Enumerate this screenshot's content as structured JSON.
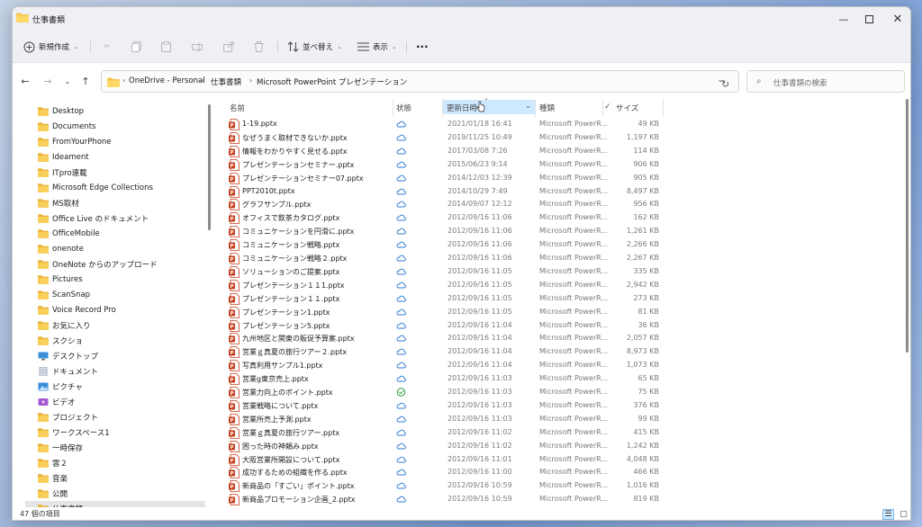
{
  "window": {
    "title": "仕事書類"
  },
  "toolbar": {
    "new_label": "新規作成",
    "sort_label": "並べ替え",
    "view_label": "表示",
    "more_label": "···"
  },
  "address": {
    "crumbs": [
      "OneDrive - Personal",
      "仕事書類",
      "Microsoft PowerPoint プレゼンテーション"
    ],
    "search_placeholder": "仕事書類の検索"
  },
  "sidebar": {
    "items": [
      "Desktop",
      "Documents",
      "FromYourPhone",
      "Ideament",
      "ITpro連載",
      "Microsoft Edge Collections",
      "MS取材",
      "Office Live のドキュメント",
      "OfficeMobile",
      "onenote",
      "OneNote からのアップロード",
      "Pictures",
      "ScanSnap",
      "Voice Record Pro",
      "お気に入り",
      "スクショ",
      "デスクトップ",
      "ドキュメント",
      "ピクチャ",
      "ビデオ",
      "プロジェクト",
      "ワークスペース1",
      "一時保存",
      "雲２",
      "音楽",
      "公開",
      "仕事書類"
    ],
    "icons": [
      "folder",
      "folder",
      "folder",
      "folder",
      "folder",
      "folder",
      "folder",
      "folder",
      "folder",
      "folder",
      "folder",
      "folder",
      "folder",
      "folder",
      "folder",
      "folder",
      "desktop",
      "document",
      "picture",
      "video",
      "folder",
      "folder",
      "folder",
      "folder",
      "folder",
      "folder",
      "folder"
    ]
  },
  "columns": {
    "name": "名前",
    "status": "状態",
    "modified": "更新日時",
    "type": "種類",
    "size": "サイズ"
  },
  "files": [
    {
      "name": "1-19.pptx",
      "status": "cloud",
      "modified": "2021/01/18 16:41",
      "type": "Microsoft PowerR...",
      "size": "49 KB"
    },
    {
      "name": "なぜうまく取材できないか.pptx",
      "status": "cloud",
      "modified": "2019/11/25 10:49",
      "type": "Microsoft PowerR...",
      "size": "1,197 KB"
    },
    {
      "name": "情報をわかりやすく見せる.pptx",
      "status": "cloud",
      "modified": "2017/03/08 7:26",
      "type": "Microsoft PowerR...",
      "size": "114 KB"
    },
    {
      "name": "プレゼンテーションセミナー.pptx",
      "status": "cloud",
      "modified": "2015/06/23 9:14",
      "type": "Microsoft PowerR...",
      "size": "906 KB"
    },
    {
      "name": "プレゼンテーションセミナー07.pptx",
      "status": "cloud",
      "modified": "2014/12/03 12:39",
      "type": "Microsoft PowerR...",
      "size": "905 KB"
    },
    {
      "name": "PPT2010t.pptx",
      "status": "cloud",
      "modified": "2014/10/29 7:49",
      "type": "Microsoft PowerR...",
      "size": "8,497 KB"
    },
    {
      "name": "グラフサンプル.pptx",
      "status": "cloud",
      "modified": "2014/09/07 12:12",
      "type": "Microsoft PowerR...",
      "size": "956 KB"
    },
    {
      "name": "オフィスで飲茶カタログ.pptx",
      "status": "cloud",
      "modified": "2012/09/16 11:06",
      "type": "Microsoft PowerR...",
      "size": "162 KB"
    },
    {
      "name": "コミュニケーションを円滑に.pptx",
      "status": "cloud",
      "modified": "2012/09/16 11:06",
      "type": "Microsoft PowerR...",
      "size": "1,261 KB"
    },
    {
      "name": "コミュニケーション戦略.pptx",
      "status": "cloud",
      "modified": "2012/09/16 11:06",
      "type": "Microsoft PowerR...",
      "size": "2,266 KB"
    },
    {
      "name": "コミュニケーション戦略２.pptx",
      "status": "cloud",
      "modified": "2012/09/16 11:06",
      "type": "Microsoft PowerR...",
      "size": "2,267 KB"
    },
    {
      "name": "ソリューションのご提案.pptx",
      "status": "cloud",
      "modified": "2012/09/16 11:05",
      "type": "Microsoft PowerR...",
      "size": "335 KB"
    },
    {
      "name": "プレゼンテーション１１1.pptx",
      "status": "cloud",
      "modified": "2012/09/16 11:05",
      "type": "Microsoft PowerR...",
      "size": "2,942 KB"
    },
    {
      "name": "プレゼンテーション１１.pptx",
      "status": "cloud",
      "modified": "2012/09/16 11:05",
      "type": "Microsoft PowerR...",
      "size": "273 KB"
    },
    {
      "name": "プレゼンテーション1.pptx",
      "status": "cloud",
      "modified": "2012/09/16 11:05",
      "type": "Microsoft PowerR...",
      "size": "81 KB"
    },
    {
      "name": "プレゼンテーション5.pptx",
      "status": "cloud",
      "modified": "2012/09/16 11:04",
      "type": "Microsoft PowerR...",
      "size": "36 KB"
    },
    {
      "name": "九州地区と関東の販促予算案.pptx",
      "status": "cloud",
      "modified": "2012/09/16 11:04",
      "type": "Microsoft PowerR...",
      "size": "2,057 KB"
    },
    {
      "name": "営業ｇ真夏の旅行ツアー２.pptx",
      "status": "cloud",
      "modified": "2012/09/16 11:04",
      "type": "Microsoft PowerR...",
      "size": "8,973 KB"
    },
    {
      "name": "写真利用サンプル1.pptx",
      "status": "cloud",
      "modified": "2012/09/16 11:04",
      "type": "Microsoft PowerR...",
      "size": "1,073 KB"
    },
    {
      "name": "営業g東京売上.pptx",
      "status": "cloud",
      "modified": "2012/09/16 11:03",
      "type": "Microsoft PowerR...",
      "size": "65 KB"
    },
    {
      "name": "営業力向上のポイント.pptx",
      "status": "synced",
      "modified": "2012/09/16 11:03",
      "type": "Microsoft PowerR...",
      "size": "75 KB"
    },
    {
      "name": "営業戦略について.pptx",
      "status": "cloud",
      "modified": "2012/09/16 11:03",
      "type": "Microsoft PowerR...",
      "size": "376 KB"
    },
    {
      "name": "営業所売上予測.pptx",
      "status": "cloud",
      "modified": "2012/09/16 11:03",
      "type": "Microsoft PowerR...",
      "size": "99 KB"
    },
    {
      "name": "営業ｇ真夏の旅行ツアー.pptx",
      "status": "cloud",
      "modified": "2012/09/16 11:02",
      "type": "Microsoft PowerR...",
      "size": "415 KB"
    },
    {
      "name": "困った時の神頼み.pptx",
      "status": "cloud",
      "modified": "2012/09/16 11:02",
      "type": "Microsoft PowerR...",
      "size": "1,242 KB"
    },
    {
      "name": "大阪営業所開設について.pptx",
      "status": "cloud",
      "modified": "2012/09/16 11:01",
      "type": "Microsoft PowerR...",
      "size": "4,048 KB"
    },
    {
      "name": "成功するための組織を作る.pptx",
      "status": "cloud",
      "modified": "2012/09/16 11:00",
      "type": "Microsoft PowerR...",
      "size": "466 KB"
    },
    {
      "name": "新商品の「すごい」ポイント.pptx",
      "status": "cloud",
      "modified": "2012/09/16 10:59",
      "type": "Microsoft PowerR...",
      "size": "1,016 KB"
    },
    {
      "name": "新商品プロモーション企画_2.pptx",
      "status": "cloud",
      "modified": "2012/09/16 10:59",
      "type": "Microsoft PowerR...",
      "size": "819 KB"
    }
  ],
  "status_bar": {
    "count": "47 個の項目"
  },
  "colors": {
    "accent": "#0067c0",
    "selection": "#cde8ff",
    "folder": "#f5c44e",
    "ppt": "#c43e1c"
  }
}
